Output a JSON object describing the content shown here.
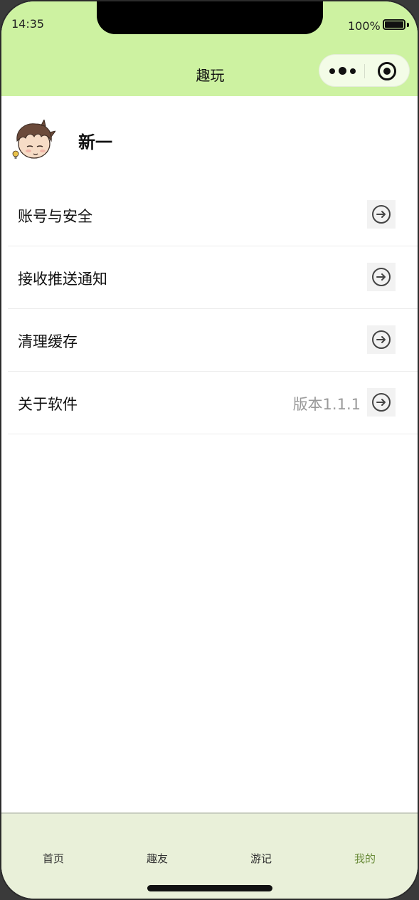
{
  "status_bar": {
    "time": "14:35",
    "battery": "100%"
  },
  "nav": {
    "title": "趣玩",
    "capsule_icons": [
      "more-icon",
      "close-target-icon"
    ]
  },
  "profile": {
    "name": "新一",
    "avatar_icon": "cartoon-avatar"
  },
  "menu": {
    "items": [
      {
        "label": "账号与安全",
        "value": "",
        "icon": "arrow-right-circle-icon"
      },
      {
        "label": "接收推送通知",
        "value": "",
        "icon": "arrow-right-circle-icon"
      },
      {
        "label": "清理缓存",
        "value": "",
        "icon": "arrow-right-circle-icon"
      },
      {
        "label": "关于软件",
        "value": "版本1.1.1",
        "icon": "arrow-right-circle-icon"
      }
    ]
  },
  "tabbar": {
    "tabs": [
      {
        "label": "首页",
        "active": false
      },
      {
        "label": "趣友",
        "active": false
      },
      {
        "label": "游记",
        "active": false
      },
      {
        "label": "我的",
        "active": true
      }
    ]
  },
  "colors": {
    "header_bg": "#cdf2a1",
    "tabbar_bg": "#e9f0d9",
    "active_tab": "#6a8c3a"
  }
}
